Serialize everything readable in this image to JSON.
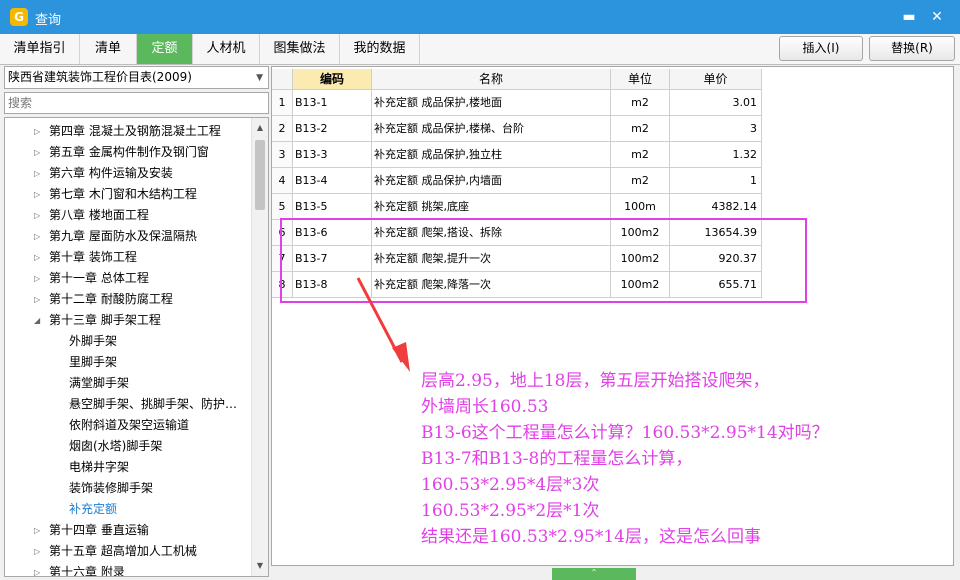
{
  "window": {
    "title": "查询",
    "app_icon_glyph": "G",
    "minimize_glyph": "▬",
    "close_glyph": "✕"
  },
  "tabs": [
    {
      "label": "清单指引",
      "active": false
    },
    {
      "label": "清单",
      "active": false
    },
    {
      "label": "定额",
      "active": true
    },
    {
      "label": "人材机",
      "active": false
    },
    {
      "label": "图集做法",
      "active": false
    },
    {
      "label": "我的数据",
      "active": false
    }
  ],
  "actions": {
    "insert_label": "插入(I)",
    "replace_label": "替换(R)"
  },
  "library": {
    "selected": "陕西省建筑装饰工程价目表(2009)",
    "search_placeholder": "搜索"
  },
  "tree": [
    {
      "label": "第四章 混凝土及钢筋混凝土工程",
      "level": 0,
      "expanded": false
    },
    {
      "label": "第五章 金属构件制作及钢门窗",
      "level": 0,
      "expanded": false
    },
    {
      "label": "第六章 构件运输及安装",
      "level": 0,
      "expanded": false
    },
    {
      "label": "第七章 木门窗和木结构工程",
      "level": 0,
      "expanded": false
    },
    {
      "label": "第八章 楼地面工程",
      "level": 0,
      "expanded": false
    },
    {
      "label": "第九章 屋面防水及保温隔热",
      "level": 0,
      "expanded": false
    },
    {
      "label": "第十章 装饰工程",
      "level": 0,
      "expanded": false
    },
    {
      "label": "第十一章 总体工程",
      "level": 0,
      "expanded": false
    },
    {
      "label": "第十二章 耐酸防腐工程",
      "level": 0,
      "expanded": false
    },
    {
      "label": "第十三章 脚手架工程",
      "level": 0,
      "expanded": true
    },
    {
      "label": "外脚手架",
      "level": 1
    },
    {
      "label": "里脚手架",
      "level": 1
    },
    {
      "label": "满堂脚手架",
      "level": 1
    },
    {
      "label": "悬空脚手架、挑脚手架、防护…",
      "level": 1
    },
    {
      "label": "依附斜道及架空运输道",
      "level": 1
    },
    {
      "label": "烟囱(水塔)脚手架",
      "level": 1
    },
    {
      "label": "电梯井字架",
      "level": 1
    },
    {
      "label": "装饰装修脚手架",
      "level": 1
    },
    {
      "label": "补充定额",
      "level": 1,
      "selected": true
    },
    {
      "label": "第十四章 垂直运输",
      "level": 0,
      "expanded": false
    },
    {
      "label": "第十五章 超高增加人工机械",
      "level": 0,
      "expanded": false
    },
    {
      "label": "第十六章 附录",
      "level": 0,
      "expanded": false
    }
  ],
  "table": {
    "headers": [
      "编码",
      "名称",
      "单位",
      "单价"
    ],
    "rows": [
      {
        "no": "1",
        "code": "B13-1",
        "name": "补充定额 成品保护,楼地面",
        "unit": "m2",
        "price": "3.01"
      },
      {
        "no": "2",
        "code": "B13-2",
        "name": "补充定额 成品保护,楼梯、台阶",
        "unit": "m2",
        "price": "3"
      },
      {
        "no": "3",
        "code": "B13-3",
        "name": "补充定额 成品保护,独立柱",
        "unit": "m2",
        "price": "1.32"
      },
      {
        "no": "4",
        "code": "B13-4",
        "name": "补充定额 成品保护,内墙面",
        "unit": "m2",
        "price": "1"
      },
      {
        "no": "5",
        "code": "B13-5",
        "name": "补充定额 挑架,底座",
        "unit": "100m",
        "price": "4382.14"
      },
      {
        "no": "6",
        "code": "B13-6",
        "name": "补充定额 爬架,搭设、拆除",
        "unit": "100m2",
        "price": "13654.39"
      },
      {
        "no": "7",
        "code": "B13-7",
        "name": "补充定额 爬架,提升一次",
        "unit": "100m2",
        "price": "920.37"
      },
      {
        "no": "8",
        "code": "B13-8",
        "name": "补充定额 爬架,降落一次",
        "unit": "100m2",
        "price": "655.71"
      }
    ]
  },
  "annotation": {
    "color": "#e040e6",
    "lines": [
      "层高2.95，地上18层，第五层开始搭设爬架，",
      "外墙周长160.53",
      "B13-6这个工程量怎么计算？160.53*2.95*14对吗？",
      "B13-7和B13-8的工程量怎么计算，",
      "160.53*2.95*4层*3次",
      "160.53*2.95*2层*1次",
      "结果还是160.53*2.95*14层，这是怎么回事"
    ]
  },
  "icons": {
    "tree_collapsed": "▷",
    "tree_expanded": "◢",
    "scroll_up": "▲",
    "scroll_down": "▼",
    "dropdown": "▼",
    "splitter": "⌃"
  },
  "colors": {
    "titlebar": "#2b94dc",
    "active_tab": "#5cb85c",
    "header_highlight": "#fcebb0",
    "selected_tree_item": "#1e7fd1"
  }
}
